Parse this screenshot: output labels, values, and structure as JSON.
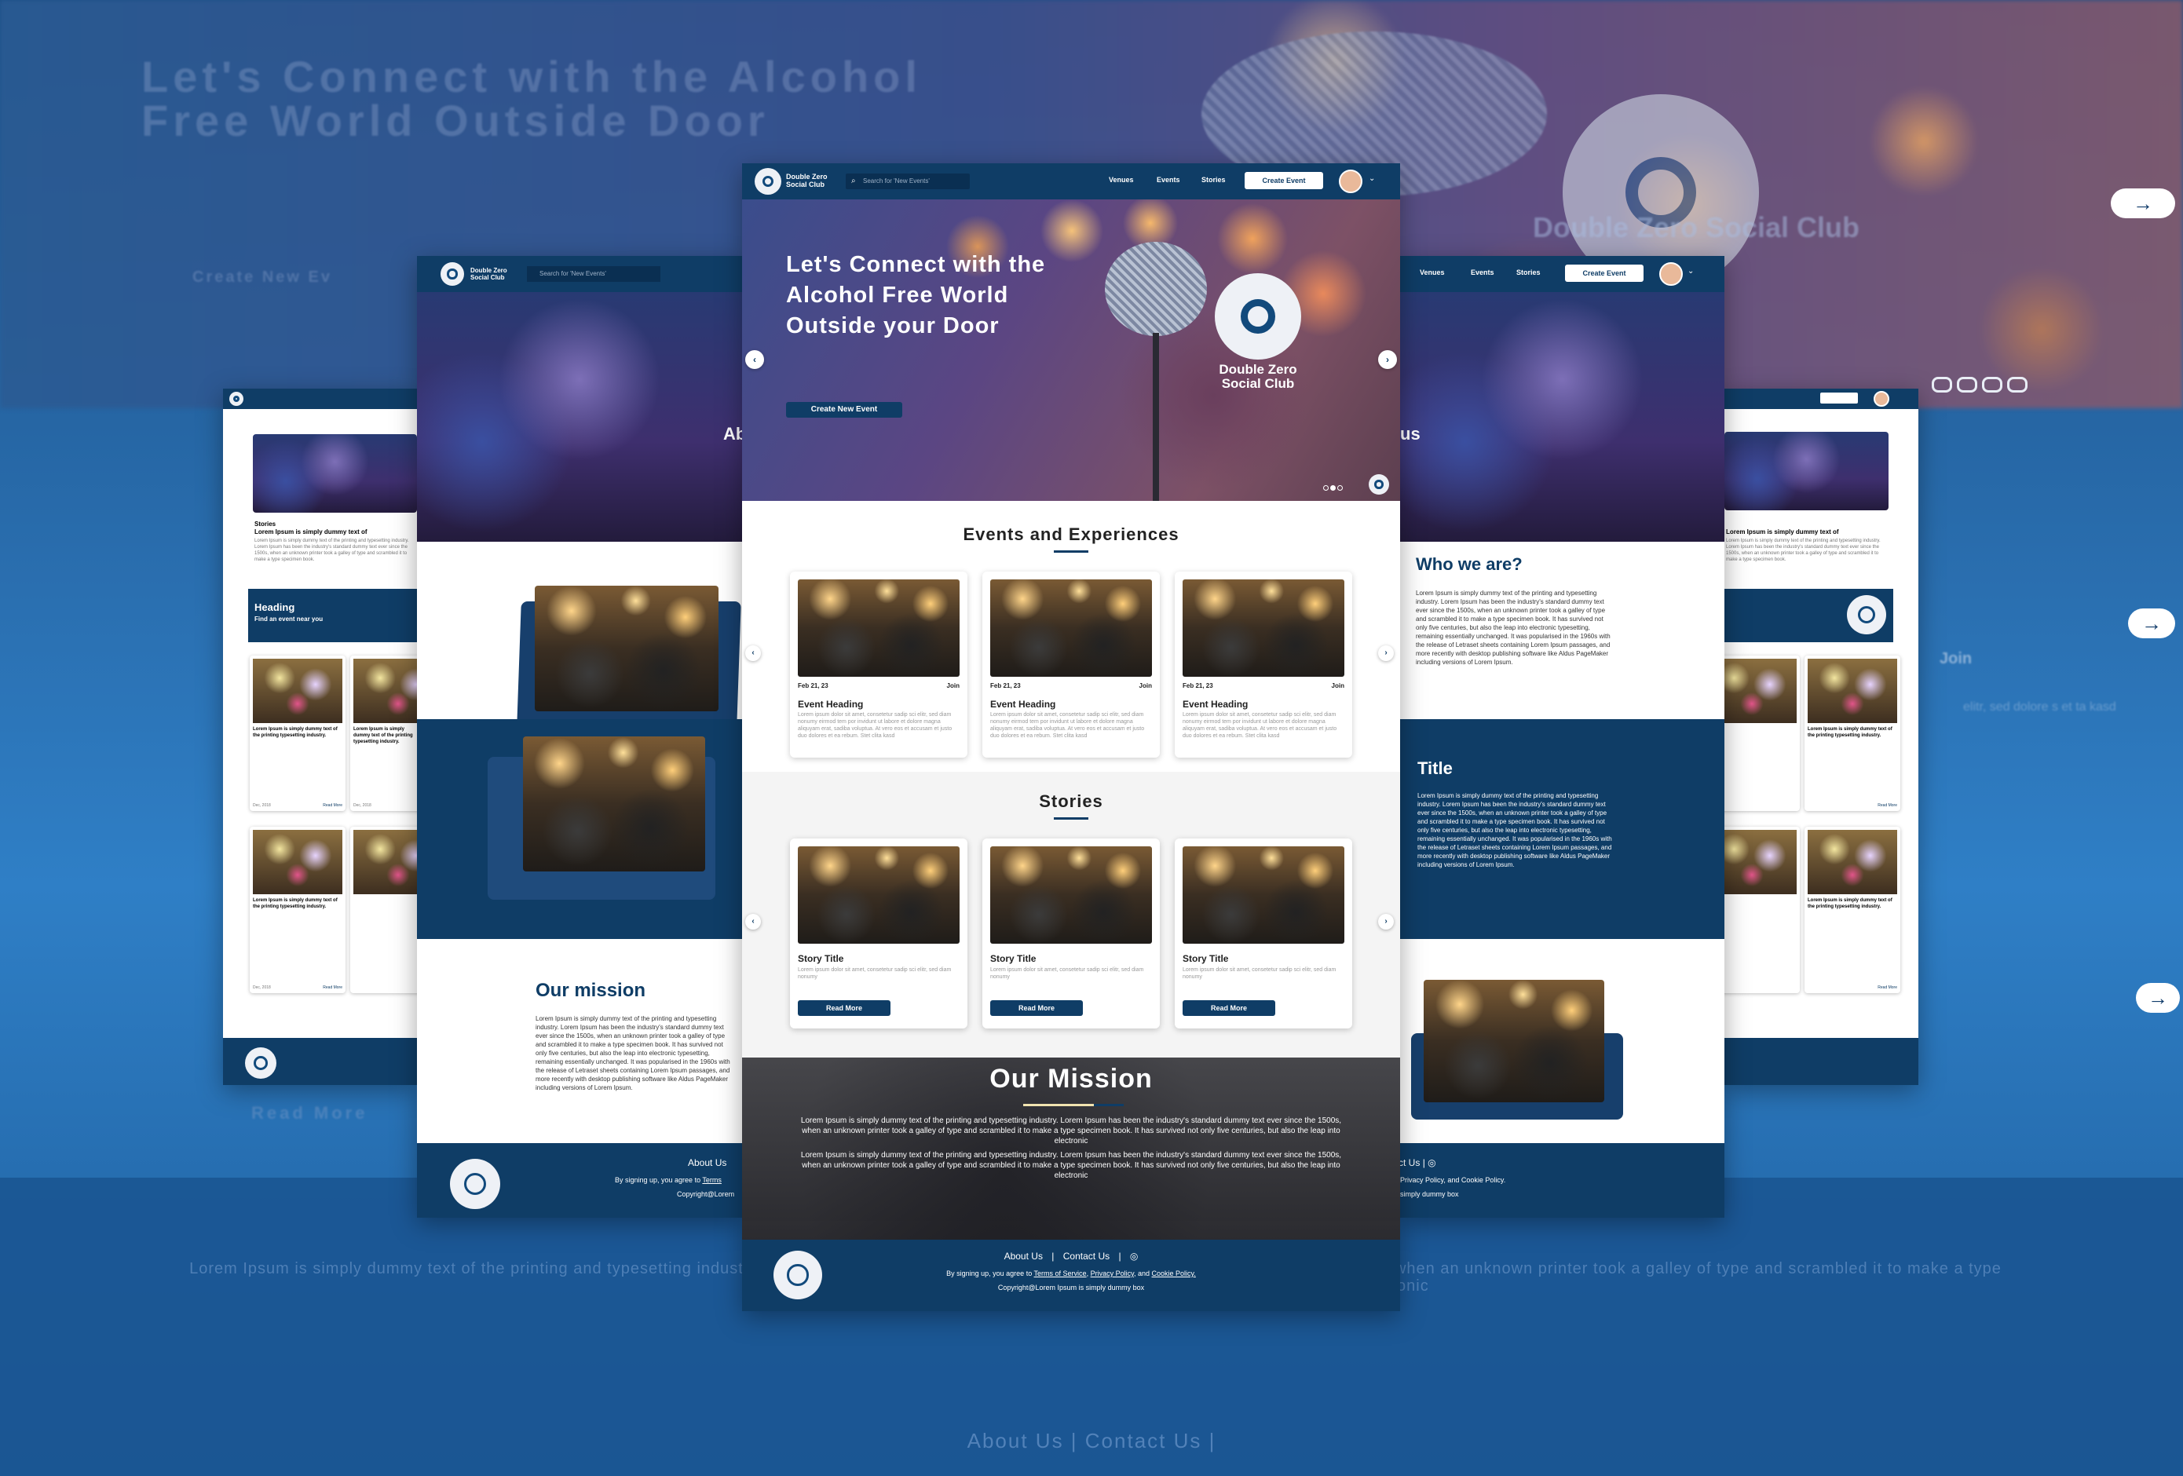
{
  "brand": {
    "name": "Double Zero Social Club",
    "name_line1": "Double Zero",
    "name_line2": "Social Club",
    "colors": {
      "navy": "#0f3d66",
      "cream": "#f1e3b0",
      "white": "#ffffff"
    }
  },
  "nav": {
    "search_placeholder": "Search for 'New Events'",
    "links": [
      "Venues",
      "Events",
      "Stories"
    ],
    "create_button": "Create Event",
    "caret": "⌄"
  },
  "hero": {
    "title": "Let's Connect with the Alcohol Free World Outside your Door",
    "cta": "Create New Event",
    "prev_arrow": "‹",
    "next_arrow": "›"
  },
  "events": {
    "section_title": "Events and Experiences",
    "items": [
      {
        "date": "Feb 21, 23",
        "action": "Join",
        "heading": "Event Heading",
        "desc": "Lorem ipsum dolor sit amet, consetetur sadip sci elitr, sed diam nonumy eirmod tem por invidunt ut labore et dolore magna aliquyam erat, sadiba voluptua. At vero eos et accusam et justo duo dolores et ea rebum. Stet clita kasd"
      },
      {
        "date": "Feb 21, 23",
        "action": "Join",
        "heading": "Event Heading",
        "desc": "Lorem ipsum dolor sit amet, consetetur sadip sci elitr, sed diam nonumy eirmod tem por invidunt ut labore et dolore magna aliquyam erat, sadiba voluptua. At vero eos et accusam et justo duo dolores et ea rebum. Stet clita kasd"
      },
      {
        "date": "Feb 21, 23",
        "action": "Join",
        "heading": "Event Heading",
        "desc": "Lorem ipsum dolor sit amet, consetetur sadip sci elitr, sed diam nonumy eirmod tem por invidunt ut labore et dolore magna aliquyam erat, sadiba voluptua. At vero eos et accusam et justo duo dolores et ea rebum. Stet clita kasd"
      }
    ]
  },
  "stories": {
    "section_title": "Stories",
    "items": [
      {
        "heading": "Story Title",
        "desc": "Lorem ipsum dolor sit amet, consetetur sadip sci elitr, sed diam nonumy",
        "button": "Read More"
      },
      {
        "heading": "Story Title",
        "desc": "Lorem ipsum dolor sit amet, consetetur sadip sci elitr, sed diam nonumy",
        "button": "Read More"
      },
      {
        "heading": "Story Title",
        "desc": "Lorem ipsum dolor sit amet, consetetur sadip sci elitr, sed diam nonumy",
        "button": "Read More"
      }
    ]
  },
  "mission": {
    "title": "Our Mission",
    "p1": "Lorem Ipsum is simply dummy text of the printing and typesetting industry. Lorem Ipsum has been the industry's standard dummy text ever since the 1500s, when an unknown printer took a galley of type and scrambled it to make a type specimen book. It has survived not only five centuries, but also the leap into electronic",
    "p2": "Lorem Ipsum is simply dummy text of the printing and typesetting industry. Lorem Ipsum has been the industry's standard dummy text ever since the 1500s, when an unknown printer took a galley of type and scrambled it to make a type specimen book. It has survived not only five centuries, but also the leap into electronic"
  },
  "footer": {
    "about": "About Us",
    "contact": "Contact Us",
    "sep": "|",
    "legal_prefix": "By signing up, you agree to",
    "terms": "Terms of Service",
    "privacy": "Privacy Policy",
    "and": "and",
    "cookie": "Cookie Policy.",
    "copyright": "Copyright@Lorem Ipsum is simply dummy box"
  },
  "left_page": {
    "about_heading": "Ab",
    "mission_heading": "Our mission",
    "mission_text": "Lorem Ipsum is simply dummy text of the printing and typesetting industry. Lorem Ipsum has been the industry's standard dummy text ever since the 1500s, when an unknown printer took a galley of type and scrambled it to make a type specimen book. It has survived not only five centuries, but also the leap into electronic typesetting, remaining essentially unchanged. It was popularised in the 1960s with the release of Letraset sheets containing Lorem Ipsum passages, and more recently with desktop publishing software like Aldus PageMaker including versions of Lorem Ipsum.",
    "footer_about": "About Us",
    "footer_legal": "By signing up, you agree to",
    "footer_terms": "Terms",
    "footer_copy": "Copyright@Lorem"
  },
  "right_page": {
    "heading_suffix": "us",
    "who_heading": "Who we are?",
    "who_text": "Lorem Ipsum is simply dummy text of the printing and typesetting industry. Lorem Ipsum has been the industry's standard dummy text ever since the 1500s, when an unknown printer took a galley of type and scrambled it to make a type specimen book. It has survived not only five centuries, but also the leap into electronic typesetting, remaining essentially unchanged. It was popularised in the 1960s with the release of Letraset sheets containing Lorem Ipsum passages, and more recently with desktop publishing software like Aldus PageMaker including versions of Lorem Ipsum.",
    "title_heading": "Title",
    "title_text": "Lorem Ipsum is simply dummy text of the printing and typesetting industry. Lorem Ipsum has been the industry's standard dummy text ever since the 1500s, when an unknown printer took a galley of type and scrambled it to make a type specimen book. It has survived not only five centuries, but also the leap into electronic typesetting, remaining essentially unchanged. It was popularised in the 1960s with the release of Letraset sheets containing Lorem Ipsum passages, and more recently with desktop publishing software like Aldus PageMaker including versions of Lorem Ipsum.",
    "footer_contact": "ct Us",
    "footer_legal": "Privacy Policy, and Cookie Policy.",
    "footer_copy": "simply dummy box"
  },
  "far_left_page": {
    "story_label": "Stories",
    "story_title": "Lorem Ipsum is simply dummy text of",
    "story_text": "Lorem Ipsum is simply dummy text of the printing and typesetting industry. Lorem Ipsum has been the industry's standard dummy text ever since the 1500s, when an unknown printer took a galley of type and scrambled it to make a type specimen book.",
    "band_heading": "Heading",
    "band_sub": "Find an event near you",
    "item_title": "Lorem Ipsum is simply dummy text of the printing typesetting industry.",
    "item_date": "Dec, 2018",
    "item_more": "Read More"
  },
  "background": {
    "hero_text": "Let's Connect with the Alcohol Free World Outside Door",
    "cta": "Create New Ev",
    "logo_text": "Double Zero Social Club",
    "join": "Join",
    "side_snippet": "elitr, sed dolore s et ta kasd",
    "read_more": "Read More",
    "bottom_text": "Lorem Ipsum is simply dummy text of the printing and typesetting industry. Lorem Ipsum has been the industry's standard dummy text ever since the 1500s, when an unknown printer took a galley of type and scrambled it to make a type specimen book. It has survived not only five centuries, but also the leap into electronic",
    "footer_links": "About Us  |  Contact Us  |",
    "arrow": "→"
  }
}
